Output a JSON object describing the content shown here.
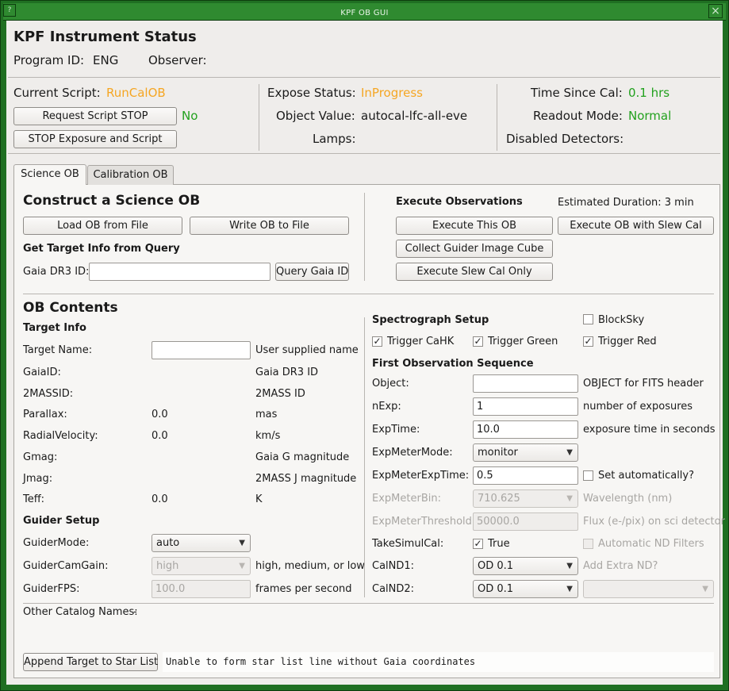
{
  "window": {
    "title": "KPF OB GUI",
    "menu_glyph": "?",
    "close_glyph": "×"
  },
  "colors": {
    "accent_orange": "#f5a623",
    "status_green": "#22a11e",
    "window_frame": "#1f6f22"
  },
  "status": {
    "heading": "KPF Instrument Status",
    "program_id_label": "Program ID:",
    "program_id": "ENG",
    "observer_label": "Observer:",
    "observer": "",
    "current_script_label": "Current Script:",
    "current_script": "RunCalOB",
    "request_stop_button": "Request Script STOP",
    "stop_requested": "No",
    "stop_exposure_button": "STOP Exposure and Script",
    "expose_status_label": "Expose Status:",
    "expose_status": "InProgress",
    "object_value_label": "Object Value:",
    "object_value": "autocal-lfc-all-eve",
    "lamps_label": "Lamps:",
    "lamps": "",
    "time_since_cal_label": "Time Since Cal:",
    "time_since_cal": "0.1 hrs",
    "readout_mode_label": "Readout Mode:",
    "readout_mode": "Normal",
    "disabled_detectors_label": "Disabled Detectors:",
    "disabled_detectors": ""
  },
  "tabs": [
    {
      "label": "Science OB",
      "active": true
    },
    {
      "label": "Calibration OB",
      "active": false
    }
  ],
  "construct": {
    "heading": "Construct a Science OB",
    "load_button": "Load OB from File",
    "write_button": "Write OB to File",
    "query_heading": "Get Target Info from Query",
    "gaia_label": "Gaia DR3 ID:",
    "gaia_value": "",
    "query_button": "Query Gaia ID"
  },
  "execute": {
    "heading": "Execute Observations",
    "estimated_duration": "Estimated Duration: 3 min",
    "execute_button": "Execute This OB",
    "execute_slew_button": "Execute OB with Slew Cal",
    "guider_cube_button": "Collect Guider Image Cube",
    "slew_only_button": "Execute Slew Cal Only"
  },
  "contents": {
    "heading": "OB Contents",
    "target_heading": "Target Info",
    "target_rows": [
      {
        "label": "Target Name:",
        "value": "",
        "hint": "User supplied name"
      },
      {
        "label": "GaiaID:",
        "value": "",
        "hint": "Gaia DR3 ID"
      },
      {
        "label": "2MASSID:",
        "value": "",
        "hint": "2MASS ID"
      },
      {
        "label": "Parallax:",
        "value": "0.0",
        "hint": "mas"
      },
      {
        "label": "RadialVelocity:",
        "value": "0.0",
        "hint": "km/s"
      },
      {
        "label": "Gmag:",
        "value": "",
        "hint": "Gaia G magnitude"
      },
      {
        "label": "Jmag:",
        "value": "",
        "hint": "2MASS J magnitude"
      },
      {
        "label": "Teff:",
        "value": "0.0",
        "hint": "K"
      }
    ],
    "guider_heading": "Guider Setup",
    "guider_mode_label": "GuiderMode:",
    "guider_mode": "auto",
    "guider_gain_label": "GuiderCamGain:",
    "guider_gain": "high",
    "guider_gain_hint": "high, medium, or low",
    "guider_fps_label": "GuiderFPS:",
    "guider_fps": "100.0",
    "guider_fps_hint": "frames per second",
    "other_names_label": "Other Catalog Names:",
    "other_names": "-"
  },
  "spectrograph": {
    "heading": "Spectrograph Setup",
    "blocksky": {
      "label": "BlockSky",
      "checked": false
    },
    "trigger_cahk": {
      "label": "Trigger CaHK",
      "checked": true
    },
    "trigger_green": {
      "label": "Trigger Green",
      "checked": true
    },
    "trigger_red": {
      "label": "Trigger Red",
      "checked": true
    },
    "sequence_heading": "First Observation Sequence",
    "object_label": "Object:",
    "object_value": "",
    "object_hint": "OBJECT for FITS header",
    "nexp_label": "nExp:",
    "nexp": "1",
    "nexp_hint": "number of exposures",
    "exptime_label": "ExpTime:",
    "exptime": "10.0",
    "exptime_hint": "exposure time in seconds",
    "expmeter_mode_label": "ExpMeterMode:",
    "expmeter_mode": "monitor",
    "expmeter_exptime_label": "ExpMeterExpTime:",
    "expmeter_exptime": "0.5",
    "set_auto": {
      "label": "Set automatically?",
      "checked": false
    },
    "expmeter_bin_label": "ExpMeterBin:",
    "expmeter_bin": "710.625",
    "expmeter_bin_hint": "Wavelength (nm)",
    "expmeter_threshold_label": "ExpMeterThreshold:",
    "expmeter_threshold": "50000.0",
    "expmeter_threshold_hint": "Flux (e-/pix) on sci detector",
    "take_simul_cal_label": "TakeSimulCal:",
    "take_simul_cal": {
      "label": "True",
      "checked": true
    },
    "auto_nd": {
      "label": "Automatic ND Filters",
      "checked": false
    },
    "calnd1_label": "CalND1:",
    "calnd1": "OD 0.1",
    "add_extra_nd": "Add Extra ND?",
    "calnd2_label": "CalND2:",
    "calnd2": "OD 0.1",
    "extra_nd": ""
  },
  "footer": {
    "append_button": "Append Target to Star List",
    "message": "Unable to form star list line without Gaia coordinates"
  }
}
